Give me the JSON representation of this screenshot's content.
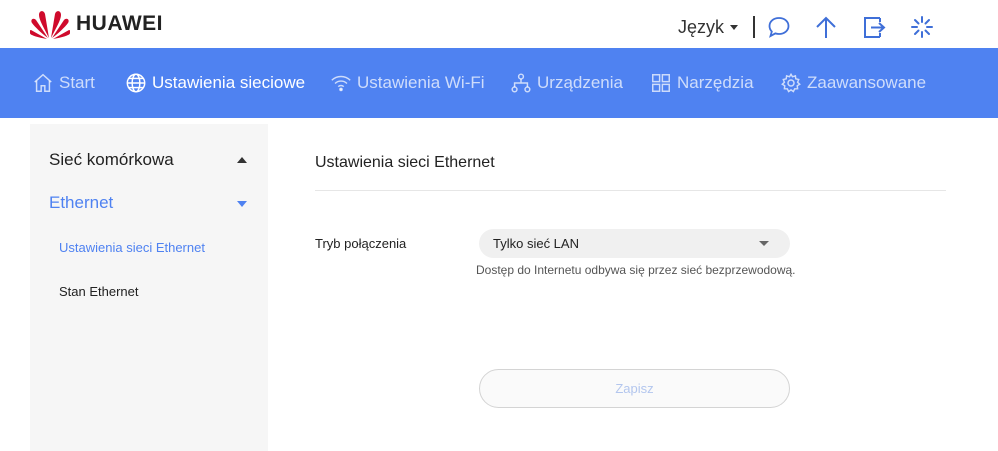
{
  "header": {
    "brand": "HUAWEI",
    "language_label": "Język",
    "icons": [
      "message-icon",
      "upload-icon",
      "logout-icon",
      "loading-icon"
    ]
  },
  "nav": {
    "items": [
      {
        "label": "Start",
        "icon": "home-icon",
        "active": false
      },
      {
        "label": "Ustawienia sieciowe",
        "icon": "globe-icon",
        "active": true
      },
      {
        "label": "Ustawienia Wi-Fi",
        "icon": "wifi-icon",
        "active": false
      },
      {
        "label": "Urządzenia",
        "icon": "devices-icon",
        "active": false
      },
      {
        "label": "Narzędzia",
        "icon": "tools-grid-icon",
        "active": false
      },
      {
        "label": "Zaawansowane",
        "icon": "gear-icon",
        "active": false
      }
    ]
  },
  "sidebar": {
    "items": [
      {
        "label": "Sieć komórkowa",
        "expanded": false
      },
      {
        "label": "Ethernet",
        "expanded": true,
        "active": true
      },
      {
        "label": "Ustawienia sieci Ethernet",
        "sub": true,
        "active": true
      },
      {
        "label": "Stan Ethernet",
        "sub": true,
        "active": false
      }
    ]
  },
  "main": {
    "title": "Ustawienia sieci Ethernet",
    "connection_mode_label": "Tryb połączenia",
    "connection_mode_value": "Tylko sieć LAN",
    "hint": "Dostęp do Internetu odbywa się przez sieć bezprzewodową.",
    "save_label": "Zapisz"
  },
  "colors": {
    "accent": "#4f82f1",
    "brand_red": "#cf0a2c",
    "sidebar_bg": "#f6f6f6"
  }
}
